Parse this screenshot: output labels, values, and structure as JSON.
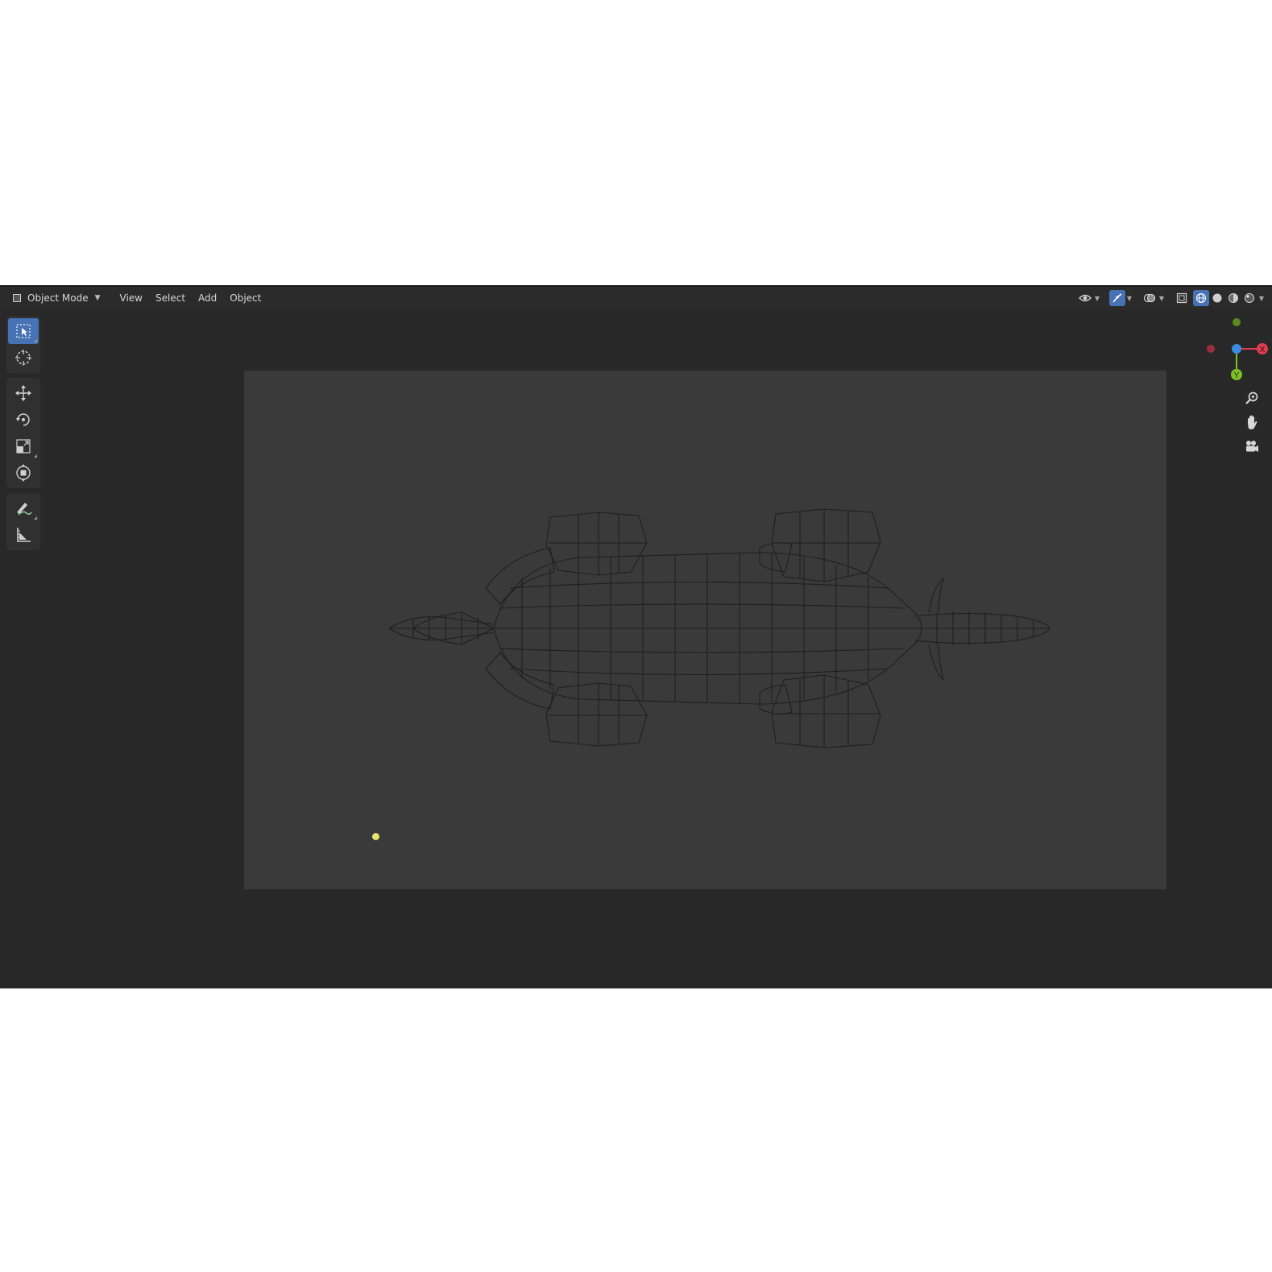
{
  "header": {
    "mode_label": "Object Mode",
    "menus": [
      "View",
      "Select",
      "Add",
      "Object"
    ]
  },
  "gizmo": {
    "x_label": "X",
    "y_label": "Y",
    "colors": {
      "x": "#e03d52",
      "y": "#7fbf26",
      "z": "#3d8be0",
      "neg_x": "#9c2f3d",
      "neg_y": "#5a8a20"
    }
  },
  "viewport": {
    "light_color": "#e8e36a",
    "frame_color": "#3a3a3a",
    "background": "#282828"
  },
  "icons": {
    "toolbar": [
      "select-box-icon",
      "cursor-icon",
      "move-icon",
      "rotate-icon",
      "scale-icon",
      "transform-icon",
      "annotate-icon",
      "measure-icon"
    ],
    "navigation": [
      "zoom-icon",
      "pan-hand-icon",
      "camera-view-icon"
    ],
    "header_right": [
      "visibility-icon",
      "gizmo-icon",
      "overlay-icon",
      "xray-icon",
      "wireframe-shading-icon",
      "solid-shading-icon",
      "material-shading-icon",
      "rendered-shading-icon"
    ]
  }
}
